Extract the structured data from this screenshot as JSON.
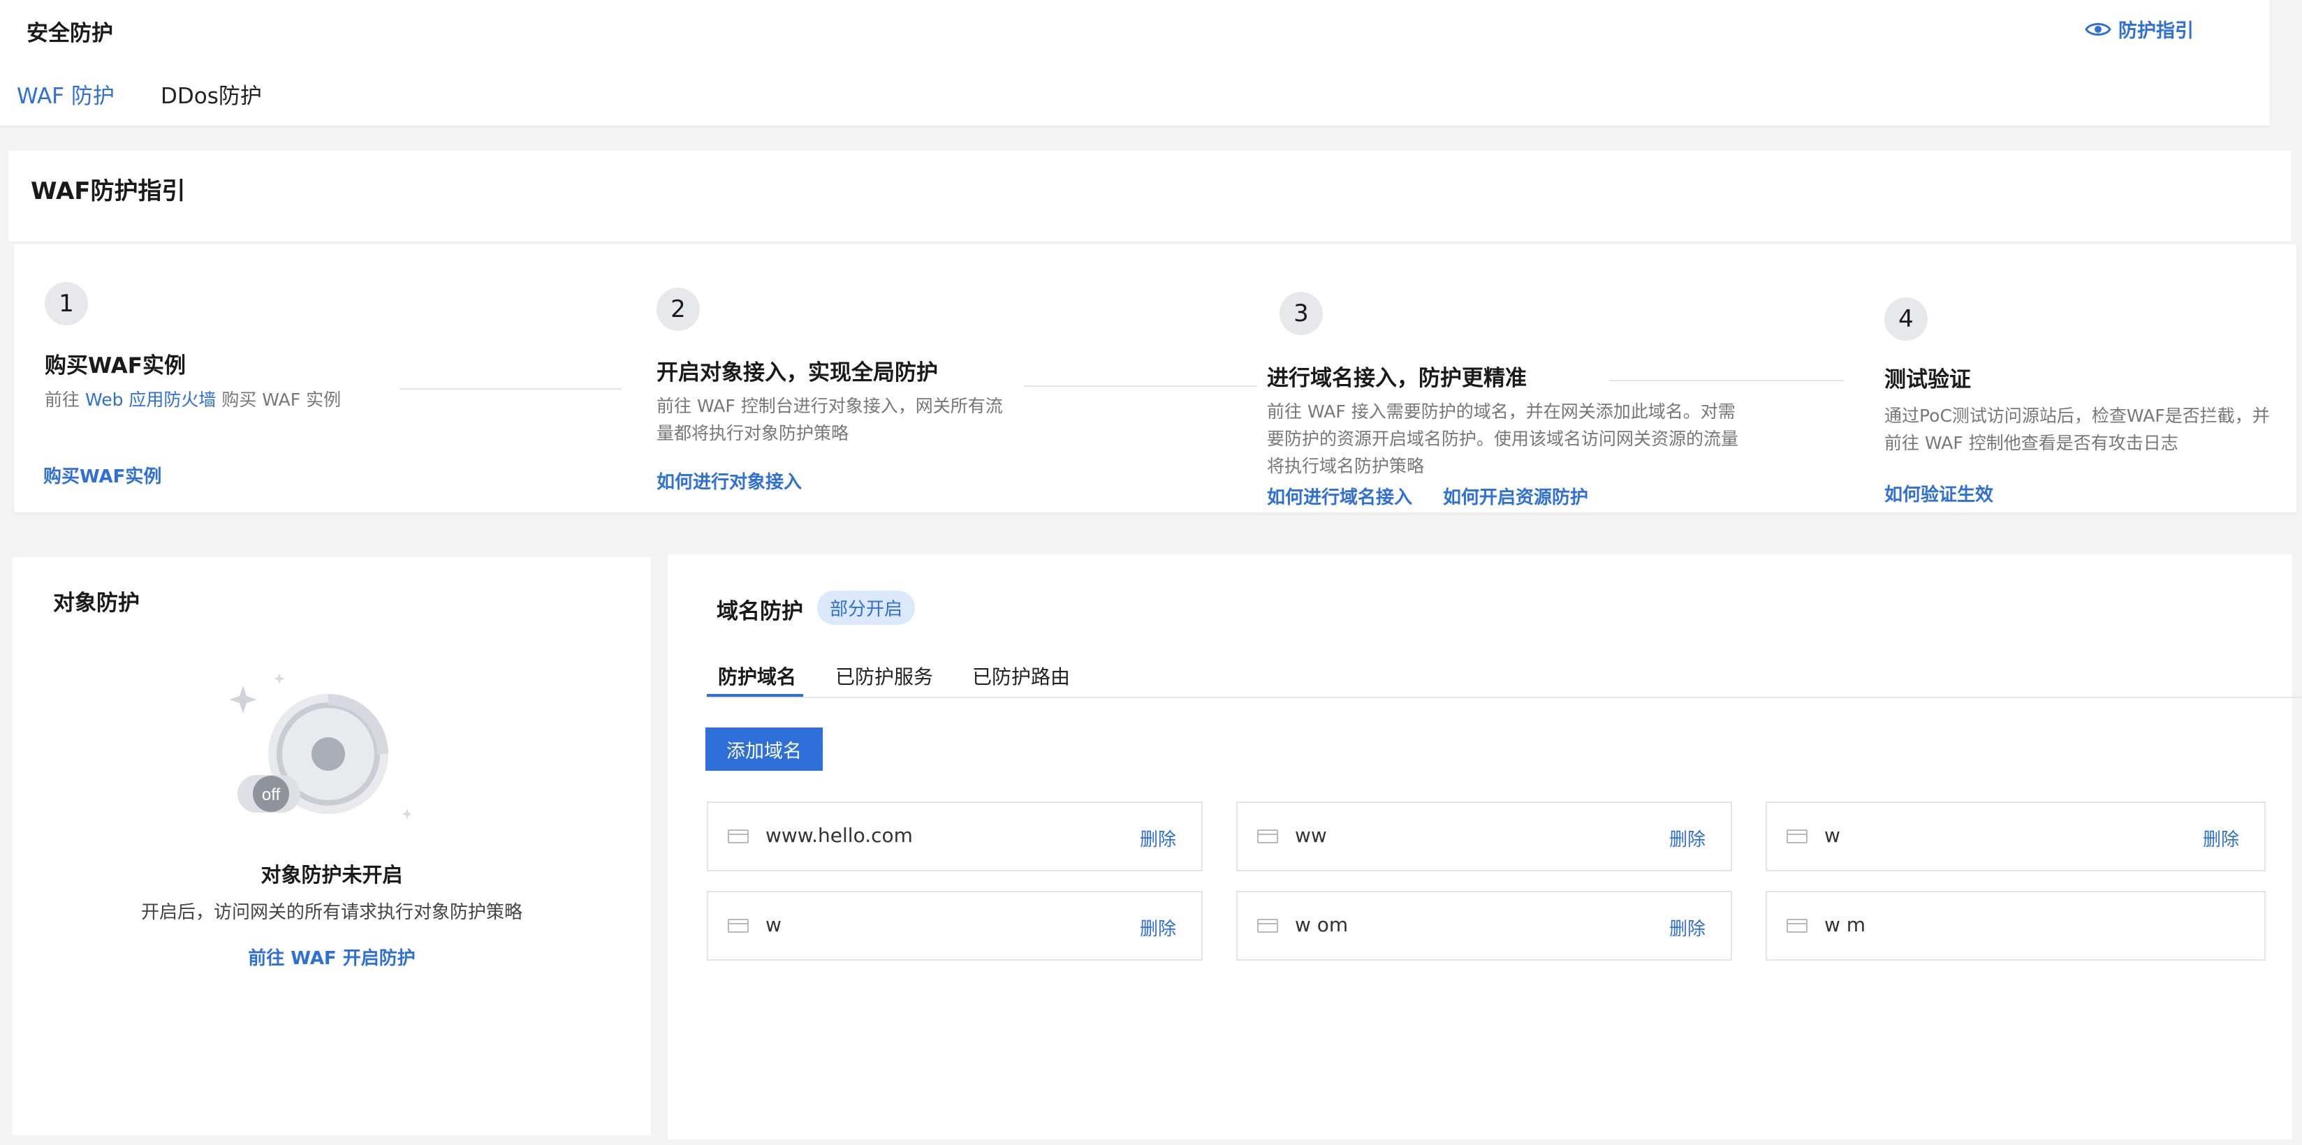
{
  "header": {
    "title": "安全防护",
    "guide_link": "防护指引",
    "tabs": [
      {
        "label": "WAF 防护",
        "active": true
      },
      {
        "label": "DDos防护",
        "active": false
      }
    ]
  },
  "guide": {
    "title": "WAF防护指引",
    "steps": [
      {
        "num": "1",
        "title": "购买WAF实例",
        "desc_prefix": "前往 ",
        "desc_link": "Web 应用防火墙",
        "desc_suffix": " 购买 WAF 实例",
        "links": [
          "购买WAF实例"
        ]
      },
      {
        "num": "2",
        "title": "开启对象接入，实现全局防护",
        "desc": "前往 WAF 控制台进行对象接入，网关所有流量都将执行对象防护策略",
        "links": [
          "如何进行对象接入"
        ]
      },
      {
        "num": "3",
        "title": "进行域名接入，防护更精准",
        "desc": "前往 WAF 接入需要防护的域名，并在网关添加此域名。对需要防护的资源开启域名防护。使用该域名访问网关资源的流量将执行域名防护策略",
        "links": [
          "如何进行域名接入",
          "如何开启资源防护"
        ]
      },
      {
        "num": "4",
        "title": "测试验证",
        "desc": "通过PoC测试访问源站后，检查WAF是否拦截，并前往 WAF 控制他查看是否有攻击日志",
        "links": [
          "如何验证生效"
        ]
      }
    ]
  },
  "object_protection": {
    "title": "对象防护",
    "badge": "off",
    "status": "对象防护未开启",
    "desc": "开启后，访问网关的所有请求执行对象防护策略",
    "link": "前往 WAF 开启防护"
  },
  "domain_protection": {
    "title": "域名防护",
    "badge": "部分开启",
    "tabs": [
      "防护域名",
      "已防护服务",
      "已防护路由"
    ],
    "add_button": "添加域名",
    "delete_label": "删除",
    "domains": [
      {
        "name": "www.hello.com",
        "deletable": true
      },
      {
        "name": "ww",
        "deletable": true
      },
      {
        "name": "w",
        "deletable": true
      },
      {
        "name": "w",
        "deletable": true
      },
      {
        "name": "w om",
        "deletable": true
      },
      {
        "name": "w m",
        "deletable": false
      }
    ]
  },
  "colors": {
    "accent": "#2f6fd9",
    "badge_bg": "#dce8fb",
    "page_bg": "#f3f3f3"
  }
}
